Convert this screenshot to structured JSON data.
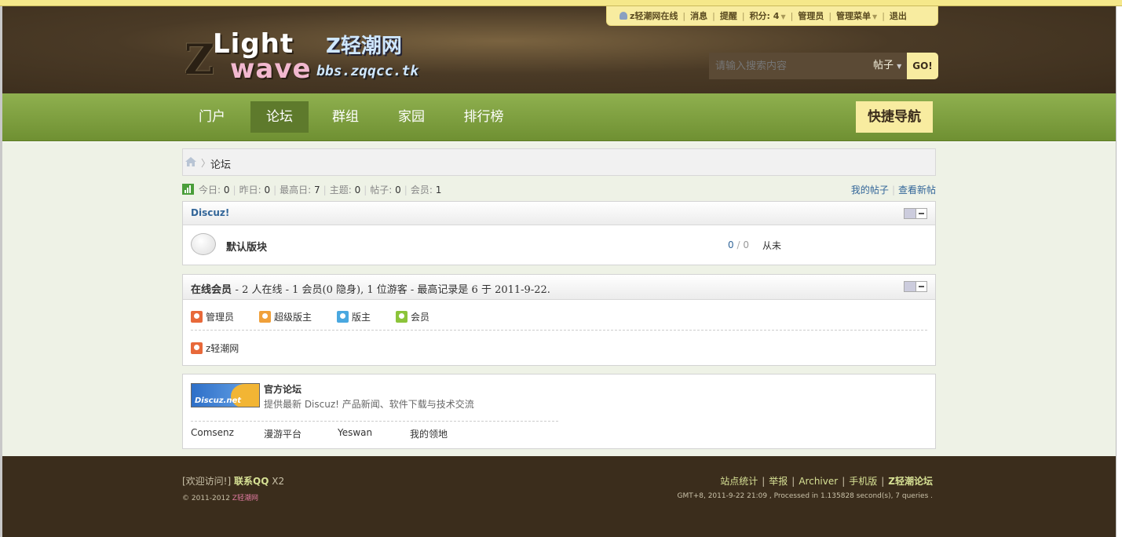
{
  "header": {
    "logo": {
      "z": "Z",
      "light": "Light",
      "wave": "wave",
      "cn": "Z轻潮网",
      "url": "bbs.zqqcc.tk"
    },
    "userbar": {
      "username": "z轻潮网在线",
      "messages": "消息",
      "reminders": "提醒",
      "credits": "积分: 4",
      "admin": "管理员",
      "admin_menu": "管理菜单",
      "logout": "退出"
    },
    "search": {
      "placeholder": "请输入搜索内容",
      "type": "帖子",
      "button": "GO!"
    }
  },
  "nav": {
    "items": [
      {
        "label": "门户"
      },
      {
        "label": "论坛"
      },
      {
        "label": "群组"
      },
      {
        "label": "家园"
      },
      {
        "label": "排行榜"
      }
    ],
    "active": "论坛",
    "quicknav": "快捷导航"
  },
  "breadcrumb": {
    "current": "论坛"
  },
  "stats": {
    "today_label": "今日:",
    "today": "0",
    "yesterday_label": "昨日:",
    "yesterday": "0",
    "max_label": "最高日:",
    "max": "7",
    "threads_label": "主题:",
    "threads": "0",
    "posts_label": "帖子:",
    "posts": "0",
    "members_label": "会员:",
    "members": "1",
    "my_posts": "我的帖子",
    "new_posts": "查看新帖"
  },
  "category": {
    "title": "Discuz!",
    "forum": {
      "name": "默认版块",
      "today": "0",
      "slash": "/",
      "total": "0",
      "last_post": "从未"
    }
  },
  "online": {
    "title": "在线会员",
    "summary": "- 2 人在线  - 1 会员(0 隐身), 1 位游客  - 最高记录是  6 于  2011-9-22.",
    "legend": [
      {
        "label": "管理员",
        "color": "#e8693a"
      },
      {
        "label": "超级版主",
        "color": "#f0a03a"
      },
      {
        "label": "版主",
        "color": "#4aa8e0"
      },
      {
        "label": "会员",
        "color": "#8cc43a"
      }
    ],
    "members": [
      {
        "name": "z轻潮网"
      }
    ]
  },
  "partners": {
    "logo_text": "Discuz.net",
    "title": "官方论坛",
    "description": "提供最新  Discuz! 产品新闻、软件下载与技术交流",
    "links": [
      "Comsenz",
      "漫游平台",
      "Yeswan",
      "我的领地"
    ]
  },
  "footer": {
    "welcome": "[欢迎访问!]",
    "qq": "联系QQ",
    "x2": "X2",
    "copyright": "© 2011-2012",
    "brand": "Z轻潮网",
    "links": [
      "站点统计",
      "举报",
      "Archiver",
      "手机版"
    ],
    "site": "Z轻潮论坛",
    "debug": "GMT+8, 2011-9-22 21:09 , Processed in 1.135828 second(s), 7 queries ."
  },
  "colors": {
    "header_bg": "#3b2d1c",
    "nav_green": "#7a9a3c",
    "accent_yellow": "#f8eca0",
    "link_blue": "#336699"
  }
}
